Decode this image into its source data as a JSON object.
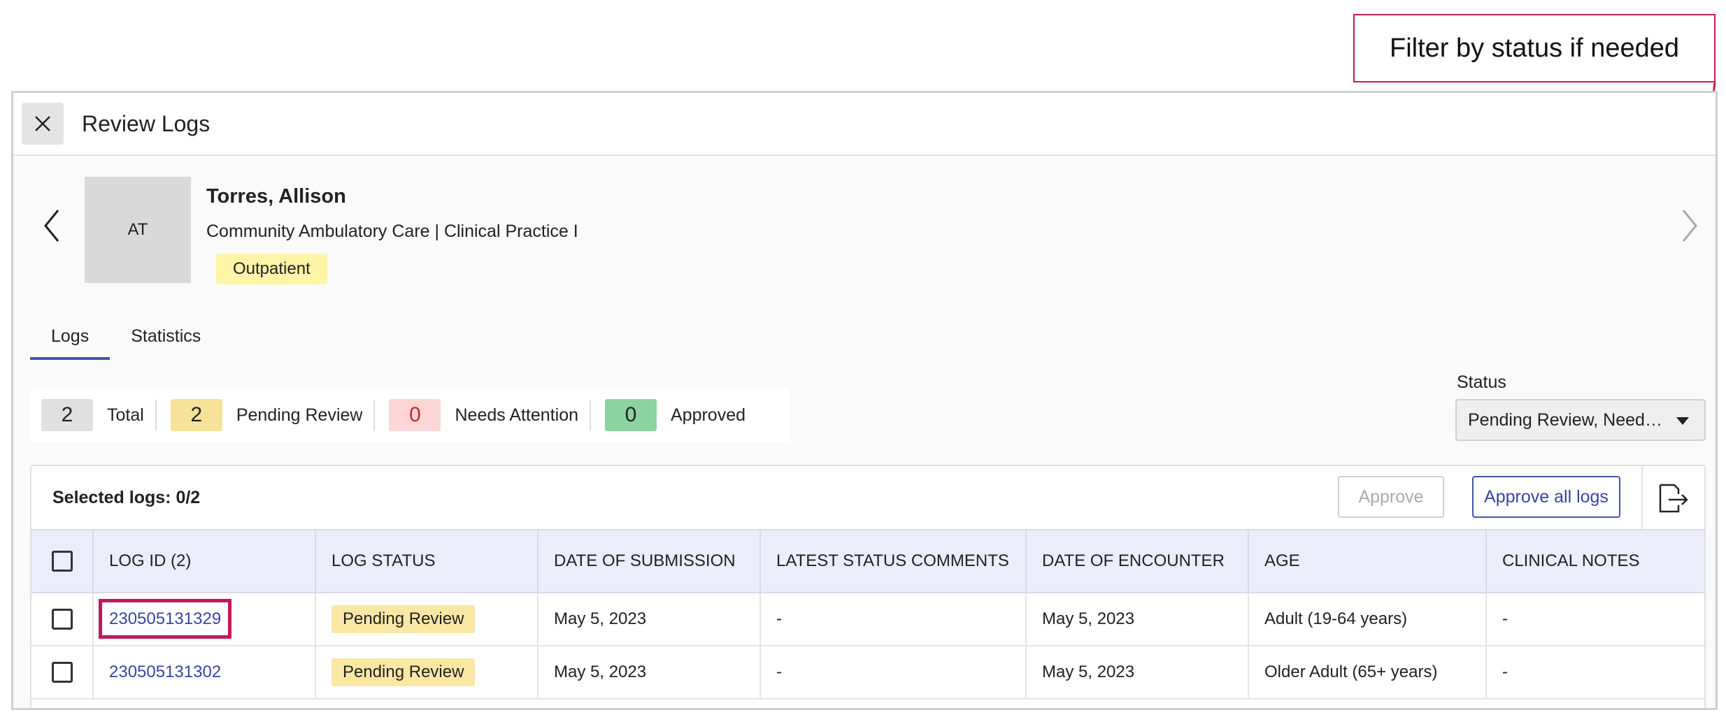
{
  "annotation": {
    "text": "Filter by status if needed"
  },
  "window": {
    "title": "Review Logs"
  },
  "profile": {
    "initials": "AT",
    "name": "Torres, Allison",
    "course": "Community Ambulatory Care | Clinical Practice I",
    "tag": "Outpatient"
  },
  "tabs": [
    {
      "label": "Logs",
      "active": true
    },
    {
      "label": "Statistics",
      "active": false
    }
  ],
  "counters": [
    {
      "count": "2",
      "label": "Total",
      "color": "#e0e0e0",
      "count_color": "#222222"
    },
    {
      "count": "2",
      "label": "Pending Review",
      "color": "#f7e29a",
      "count_color": "#222222"
    },
    {
      "count": "0",
      "label": "Needs Attention",
      "color": "#fcd6d6",
      "count_color": "#c62828"
    },
    {
      "count": "0",
      "label": "Approved",
      "color": "#8dd3a0",
      "count_color": "#222222"
    }
  ],
  "status_filter": {
    "label": "Status",
    "value": "Pending Review, Need…"
  },
  "table": {
    "selected_text": "Selected logs: 0/2",
    "approve_label": "Approve",
    "approve_all_label": "Approve all logs",
    "columns": [
      "LOG ID (2)",
      "LOG STATUS",
      "DATE OF SUBMISSION",
      "LATEST STATUS COMMENTS",
      "DATE OF ENCOUNTER",
      "AGE",
      "CLINICAL NOTES"
    ],
    "rows": [
      {
        "log_id": "230505131329",
        "status": "Pending Review",
        "submitted": "May 5, 2023",
        "comments": "-",
        "encounter": "May 5, 2023",
        "age": "Adult (19-64 years)",
        "notes": "-"
      },
      {
        "log_id": "230505131302",
        "status": "Pending Review",
        "submitted": "May 5, 2023",
        "comments": "-",
        "encounter": "May 5, 2023",
        "age": "Older Adult (65+ years)",
        "notes": "-"
      }
    ]
  },
  "colors": {
    "accent": "#4a52a8",
    "annotation": "#c2185b",
    "pending": "#fae7a5",
    "header_bg": "#ecedfb"
  }
}
